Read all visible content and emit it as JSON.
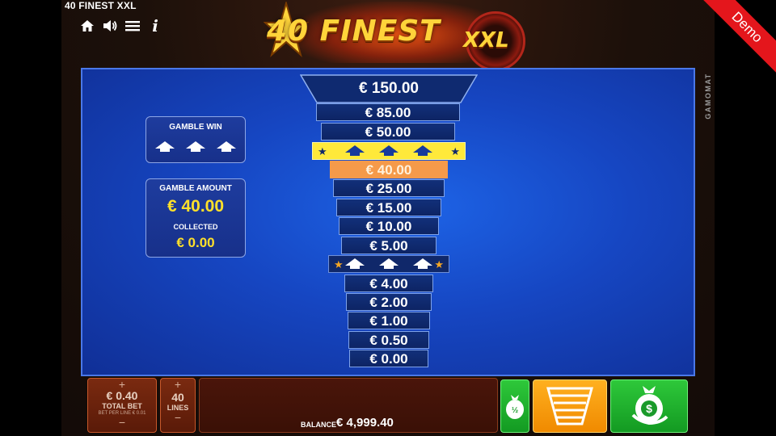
{
  "game": {
    "name": "40 FINEST XXL",
    "logo_main": "40 FINEST",
    "logo_badge": "XXL",
    "demo_label": "Demo",
    "provider": "GAMOMAT"
  },
  "top_icons": [
    "home-icon",
    "sound-icon",
    "menu-icon",
    "info-icon"
  ],
  "info_glyph": "i",
  "gamble_win": {
    "title": "GAMBLE WIN",
    "arrows": 3
  },
  "gamble_amount": {
    "title": "GAMBLE AMOUNT",
    "amount": "€ 40.00",
    "collected_label": "COLLECTED",
    "collected_value": "€ 0.00"
  },
  "ladder": {
    "top_prize": "€ 150.00",
    "upper_steps": [
      "€ 85.00",
      "€ 50.00"
    ],
    "middle_steps": [
      "€ 40.00",
      "€ 25.00",
      "€ 15.00",
      "€ 10.00",
      "€ 5.00"
    ],
    "lower_steps": [
      "€ 4.00",
      "€ 2.00",
      "€ 1.00",
      "€ 0.50",
      "€ 0.00"
    ],
    "active_step": "€ 40.00",
    "star_glyph": "★"
  },
  "controls": {
    "plus": "+",
    "minus": "−",
    "total_bet_value": "€ 0.40",
    "total_bet_label": "TOTAL BET",
    "bet_per_line": "BET PER LINE € 0.01",
    "lines_value": "40",
    "lines_label": "LINES",
    "balance_label": "BALANCE",
    "balance_value": "€ 4,999.40"
  },
  "colors": {
    "board_blue": "#1646c2",
    "active_step": "#f59a4a",
    "yellow_divider": "#ffe93a",
    "green_button": "#1fb02e",
    "orange_button": "#f59a0a",
    "demo_red": "#e4161c"
  }
}
